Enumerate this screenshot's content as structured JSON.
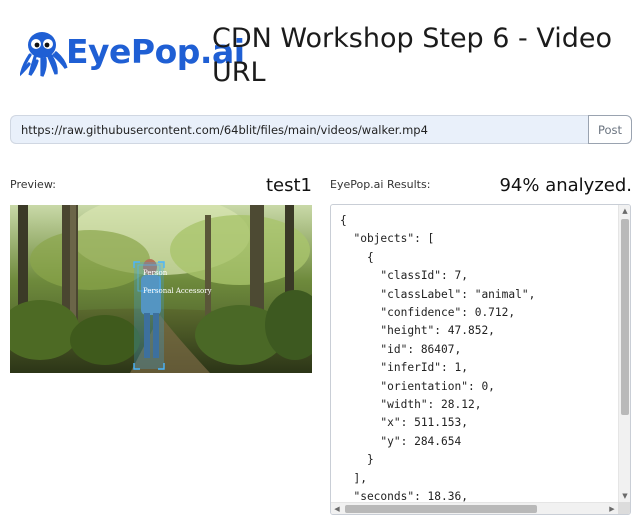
{
  "logo": {
    "part1": "EyePop",
    "part2": ".ai"
  },
  "title": "CDN Workshop Step 6 - Video URL",
  "url_form": {
    "value": "https://raw.githubusercontent.com/64blit/files/main/videos/walker.mp4",
    "button_label": "Post"
  },
  "preview": {
    "label": "Preview:",
    "status": "test1",
    "detections": [
      "Person",
      "Personal Accessory"
    ]
  },
  "results": {
    "label": "EyePop.ai Results:",
    "status": "94% analyzed.",
    "json_lines": [
      "{",
      "  \"objects\": [",
      "    {",
      "      \"classId\": 7,",
      "      \"classLabel\": \"animal\",",
      "      \"confidence\": 0.712,",
      "      \"height\": 47.852,",
      "      \"id\": 86407,",
      "      \"inferId\": 1,",
      "      \"orientation\": 0,",
      "      \"width\": 28.12,",
      "      \"x\": 511.153,",
      "      \"y\": 284.654",
      "    }",
      "  ],",
      "  \"seconds\": 18.36,"
    ]
  },
  "colors": {
    "brand_blue": "#1f5fd4",
    "input_bg": "#e9f0fa",
    "detection_box": "#3ea6e0"
  }
}
